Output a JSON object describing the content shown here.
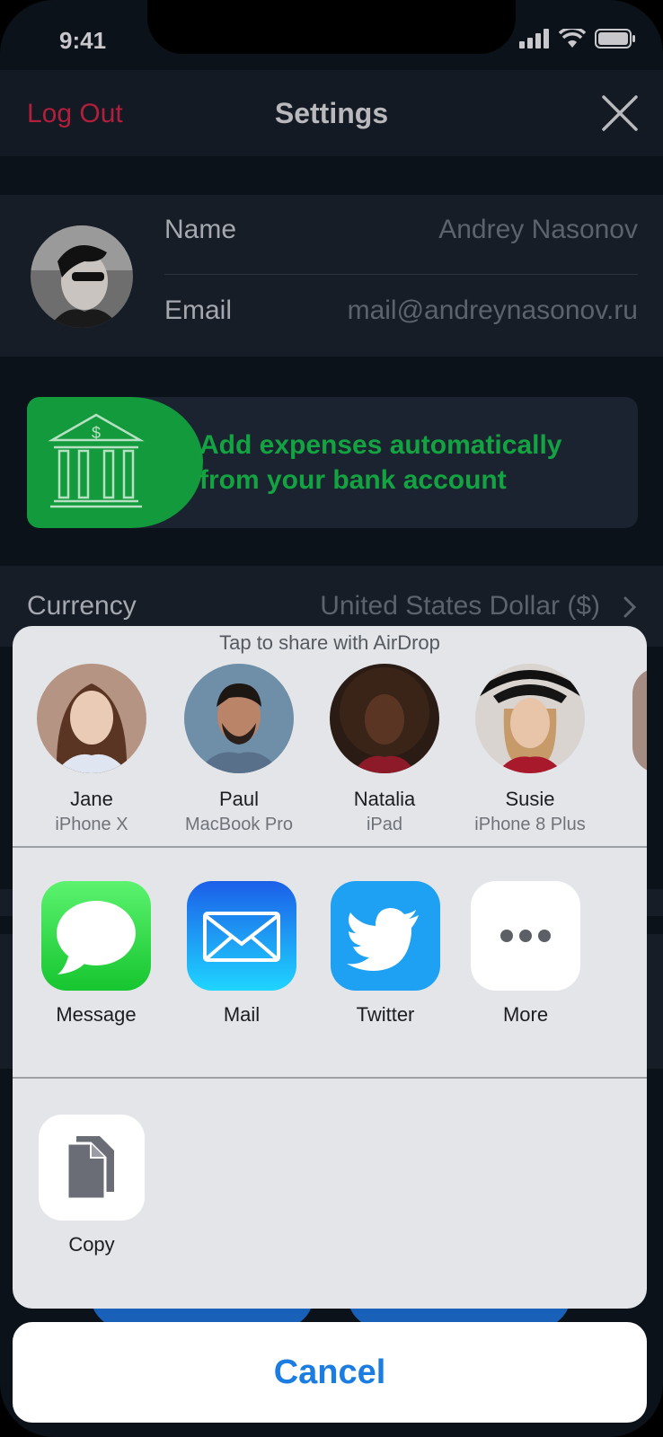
{
  "status": {
    "time": "9:41"
  },
  "nav": {
    "logout": "Log Out",
    "title": "Settings"
  },
  "profile": {
    "name_label": "Name",
    "name_value": "Andrey Nasonov",
    "email_label": "Email",
    "email_value": "mail@andreynasonov.ru"
  },
  "bank": {
    "text": "Add expenses automatically from your bank account"
  },
  "currency": {
    "label": "Currency",
    "value": "United States Dollar ($)"
  },
  "share": {
    "airdrop_title": "Tap to share with AirDrop",
    "people": [
      {
        "name": "Jane",
        "device": "iPhone X"
      },
      {
        "name": "Paul",
        "device": "MacBook Pro"
      },
      {
        "name": "Natalia",
        "device": "iPad"
      },
      {
        "name": "Susie",
        "device": "iPhone 8 Plus"
      }
    ],
    "apps": [
      {
        "label": "Message",
        "icon": "message-icon"
      },
      {
        "label": "Mail",
        "icon": "mail-icon"
      },
      {
        "label": "Twitter",
        "icon": "twitter-icon"
      },
      {
        "label": "More",
        "icon": "more-icon"
      }
    ],
    "copy_label": "Copy",
    "cancel": "Cancel"
  },
  "colors": {
    "logout": "#b01f3b",
    "bank_green": "#129a3c",
    "cancel_blue": "#1b7ce2"
  }
}
